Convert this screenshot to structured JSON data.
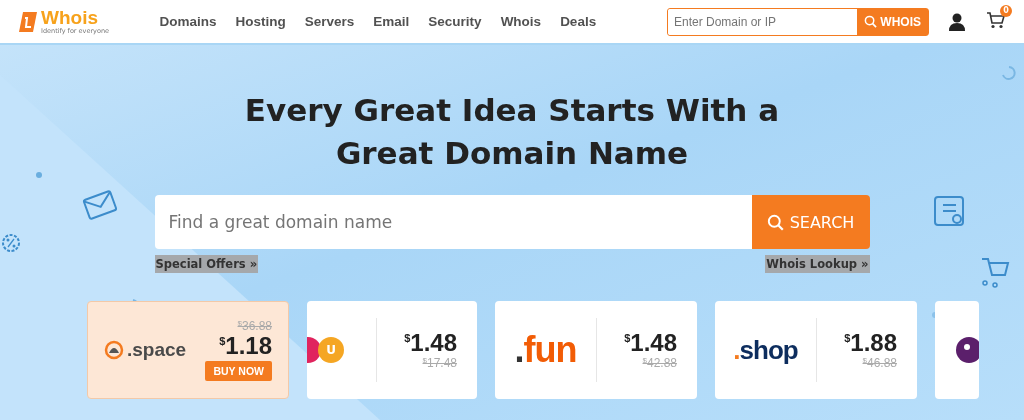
{
  "header": {
    "logo": {
      "name": "Whois",
      "tagline": "Identify for everyone"
    },
    "nav": [
      {
        "label": "Domains"
      },
      {
        "label": "Hosting"
      },
      {
        "label": "Servers"
      },
      {
        "label": "Email"
      },
      {
        "label": "Security"
      },
      {
        "label": "Whois"
      },
      {
        "label": "Deals"
      }
    ],
    "lookup": {
      "placeholder": "Enter Domain or IP",
      "button": "WHOIS"
    },
    "cart_count": "0"
  },
  "hero": {
    "title_lines": [
      "Every Great Idea Starts With a",
      "Great Domain Name"
    ],
    "search": {
      "placeholder": "Find a great domain name",
      "button": "SEARCH"
    },
    "links": [
      "Special Offers »",
      "Whois Lookup »"
    ]
  },
  "cards": [
    {
      "kind": "featured",
      "logo": ".space",
      "color": "#4a4a4a",
      "old_currency": "$",
      "old_price": "36.88",
      "currency": "$",
      "price": "1.18",
      "button": "BUY NOW"
    },
    {
      "kind": "badge",
      "logo": "U",
      "color": "#f5a623",
      "currency": "$",
      "price": "1.48",
      "old_currency": "$",
      "old_price": "17.48"
    },
    {
      "kind": "wordmark",
      "mark": ".",
      "logo": "fun",
      "color": "#f25c05",
      "currency": "$",
      "price": "1.48",
      "old_currency": "$",
      "old_price": "42.88"
    },
    {
      "kind": "wordmark",
      "mark": ".",
      "logo": "shop",
      "color": "#0d2d5e",
      "currency": "$",
      "price": "1.88",
      "old_currency": "$",
      "old_price": "46.88"
    },
    {
      "kind": "partial",
      "color": "#5b1f6b"
    }
  ]
}
